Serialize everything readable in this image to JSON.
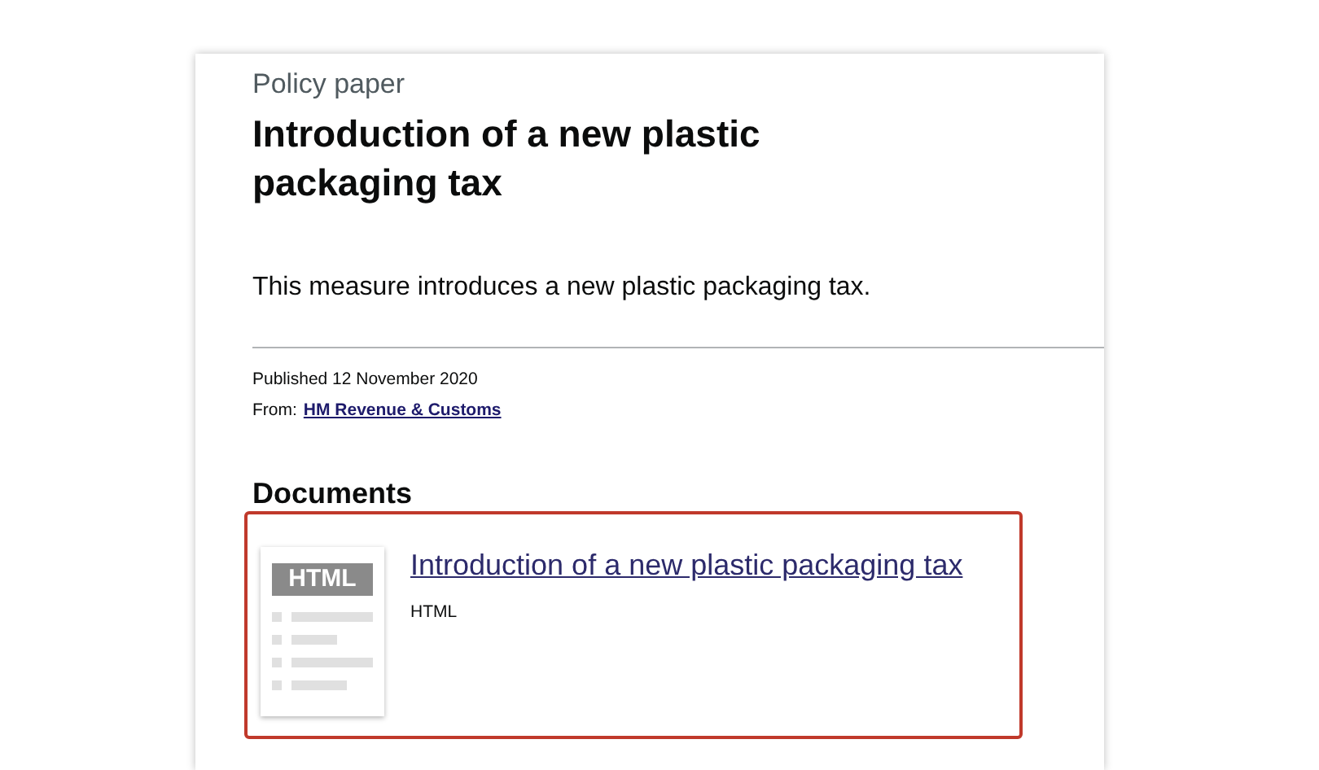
{
  "header": {
    "kind_label": "Policy paper",
    "title": "Introduction of a new plastic packaging tax"
  },
  "summary": "This measure introduces a new plastic packaging tax.",
  "metadata": {
    "published": "Published 12 November 2020",
    "from_label": "From:",
    "from_link": "HM Revenue & Customs"
  },
  "documents": {
    "heading": "Documents",
    "items": [
      {
        "title": "Introduction of a new plastic packaging tax",
        "format": "HTML",
        "thumbnail_label": "HTML",
        "highlighted": true
      }
    ]
  }
}
